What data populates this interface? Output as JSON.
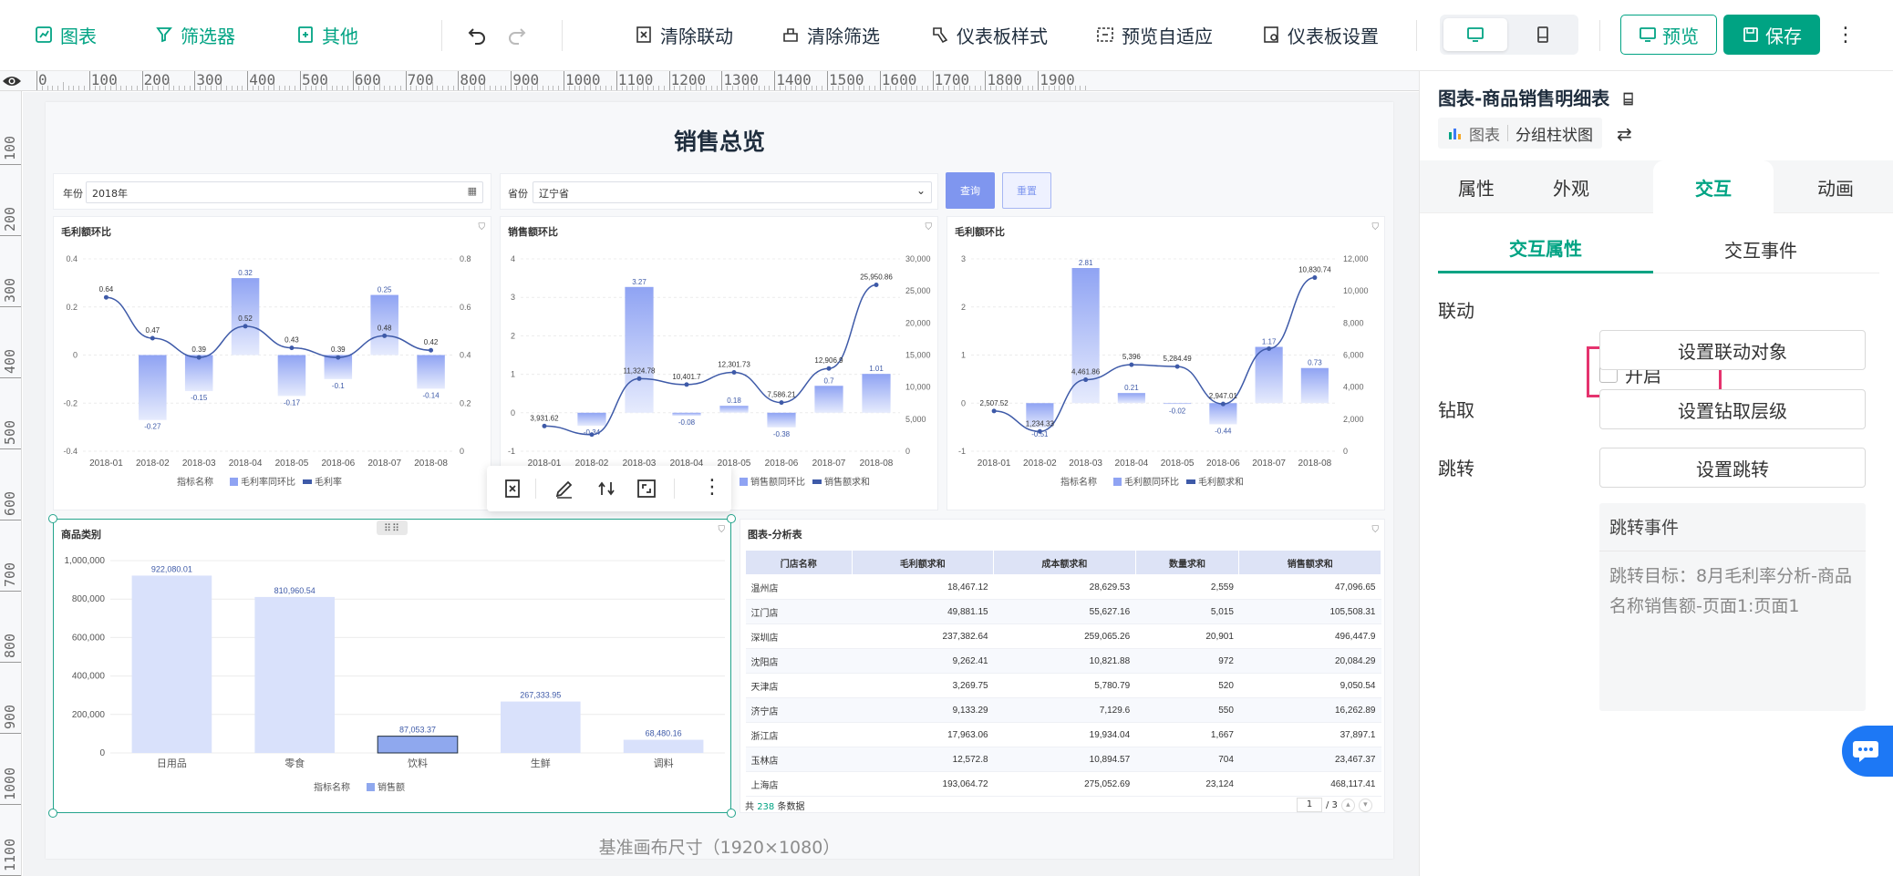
{
  "toolbar": {
    "chart_label": "图表",
    "filter_label": "筛选器",
    "other_label": "其他",
    "clear_link_label": "清除联动",
    "clear_filter_label": "清除筛选",
    "dashboard_style_label": "仪表板样式",
    "preview_adapt_label": "预览自适应",
    "dashboard_settings_label": "仪表板设置",
    "preview_label": "预览",
    "save_label": "保存",
    "accent_color": "#00a383"
  },
  "ruler": {
    "h_ticks": [
      "0",
      "100",
      "200",
      "300",
      "400",
      "500",
      "600",
      "700",
      "800",
      "900",
      "1000",
      "1100",
      "1200",
      "1300",
      "1400",
      "1500",
      "1600",
      "1700",
      "1800",
      "1900"
    ],
    "v_ticks": [
      "100",
      "200",
      "300",
      "400",
      "500",
      "600",
      "700",
      "800",
      "900",
      "1000",
      "1100"
    ]
  },
  "dashboard": {
    "title": "销售总览",
    "base_size": "基准画布尺寸（1920×1080）",
    "filter_year_label": "年份",
    "filter_year_value": "2018年",
    "filter_province_label": "省份",
    "filter_province_value": "辽宁省",
    "query_label": "查询",
    "reset_label": "重置"
  },
  "chart_data": [
    {
      "type": "bar",
      "title": "毛利额环比",
      "categories": [
        "2018-01",
        "2018-02",
        "2018-03",
        "2018-04",
        "2018-05",
        "2018-06",
        "2018-07",
        "2018-08"
      ],
      "series": [
        {
          "name": "毛利率同环比",
          "type": "bar",
          "values": [
            null,
            -0.27,
            -0.15,
            0.32,
            -0.17,
            -0.1,
            0.25,
            -0.14
          ]
        },
        {
          "name": "毛利率",
          "type": "line",
          "values": [
            0.64,
            0.47,
            0.39,
            0.52,
            0.43,
            0.39,
            0.48,
            0.42
          ]
        }
      ],
      "ylim_left": [
        -0.4,
        0.4
      ],
      "yticks_left": [
        "0.4",
        "0.2",
        "0",
        "-0.2",
        "-0.4"
      ],
      "ylim_right": [
        0,
        0.8
      ],
      "yticks_right": [
        "0.8",
        "0.6",
        "0.4",
        "0.2",
        "0"
      ],
      "legend_title": "指标名称"
    },
    {
      "type": "bar",
      "title": "销售额环比",
      "categories": [
        "2018-01",
        "2018-02",
        "2018-03",
        "2018-04",
        "2018-05",
        "2018-06",
        "2018-07",
        "2018-08"
      ],
      "series": [
        {
          "name": "销售额同环比",
          "type": "bar",
          "values": [
            null,
            -0.34,
            3.27,
            -0.08,
            0.18,
            -0.38,
            0.7,
            1.01
          ]
        },
        {
          "name": "销售额求和",
          "type": "line",
          "values": [
            3931.62,
            2595.6,
            11324.78,
            10401.7,
            12301.73,
            7586.21,
            12906.9,
            25950.86
          ]
        }
      ],
      "ylim_left": [
        -1,
        4
      ],
      "yticks_left": [
        "4",
        "3",
        "2",
        "1",
        "0",
        "-1"
      ],
      "ylim_right": [
        0,
        30000
      ],
      "yticks_right": [
        "30,000",
        "25,000",
        "20,000",
        "15,000",
        "10,000",
        "5,000",
        "0"
      ],
      "data_labels_line": [
        "3,931.62",
        "",
        "11,324.78",
        "10,401.7",
        "12,301.73",
        "7,586.21",
        "12,906.9",
        "25,950.86"
      ]
    },
    {
      "type": "bar",
      "title": "毛利额环比",
      "categories": [
        "2018-01",
        "2018-02",
        "2018-03",
        "2018-04",
        "2018-05",
        "2018-06",
        "2018-07",
        "2018-08"
      ],
      "series": [
        {
          "name": "毛利额同环比",
          "type": "bar",
          "values": [
            null,
            -0.51,
            2.81,
            0.21,
            -0.02,
            -0.44,
            1.17,
            0.73
          ]
        },
        {
          "name": "毛利额求和",
          "type": "line",
          "values": [
            2507.52,
            1234.33,
            4461.86,
            5396,
            5284.49,
            2947.01,
            6400,
            10830.74
          ]
        }
      ],
      "ylim_left": [
        -1,
        3
      ],
      "yticks_left": [
        "3",
        "2",
        "1",
        "0",
        "-1"
      ],
      "ylim_right": [
        0,
        12000
      ],
      "yticks_right": [
        "12,000",
        "10,000",
        "8,000",
        "6,000",
        "4,000",
        "2,000",
        "0"
      ],
      "legend_title": "指标名称",
      "data_labels_line": [
        "2,507.52",
        "1,234.33",
        "4,461.86",
        "5,396",
        "5,284.49",
        "2,947.01",
        "",
        "10,830.74"
      ]
    },
    {
      "type": "bar",
      "title": "商品类别",
      "categories": [
        "日用品",
        "零食",
        "饮料",
        "生鲜",
        "调料"
      ],
      "series": [
        {
          "name": "销售额",
          "values": [
            922080.01,
            810960.54,
            87053.37,
            267333.95,
            68480.16
          ]
        }
      ],
      "data_labels": [
        "922,080.01",
        "810,960.54",
        "87,053.37",
        "267,333.95",
        "68,480.16"
      ],
      "ylim": [
        0,
        1000000
      ],
      "yticks": [
        "1,000,000",
        "800,000",
        "600,000",
        "400,000",
        "200,000",
        "0"
      ],
      "legend_title": "指标名称"
    }
  ],
  "table": {
    "title": "图表-分析表",
    "columns": [
      "门店名称",
      "毛利额求和",
      "成本额求和",
      "数量求和",
      "销售额求和"
    ],
    "rows": [
      [
        "温州店",
        "18,467.12",
        "28,629.53",
        "2,559",
        "47,096.65"
      ],
      [
        "江门店",
        "49,881.15",
        "55,627.16",
        "5,015",
        "105,508.31"
      ],
      [
        "深圳店",
        "237,382.64",
        "259,065.26",
        "20,901",
        "496,447.9"
      ],
      [
        "沈阳店",
        "9,262.41",
        "10,821.88",
        "972",
        "20,084.29"
      ],
      [
        "天津店",
        "3,269.75",
        "5,780.79",
        "520",
        "9,050.54"
      ],
      [
        "济宁店",
        "9,133.29",
        "7,129.6",
        "550",
        "16,262.89"
      ],
      [
        "浙江店",
        "17,963.06",
        "19,934.04",
        "1,667",
        "37,897.1"
      ],
      [
        "玉林店",
        "12,572.8",
        "10,894.57",
        "704",
        "23,467.37"
      ],
      [
        "上海店",
        "193,064.72",
        "275,052.69",
        "23,124",
        "468,117.41"
      ]
    ],
    "footer_prefix": "共",
    "footer_count": "238",
    "footer_suffix": "条数据",
    "page_current": "1",
    "page_total": "/ 3"
  },
  "side_panel": {
    "title": "图表-商品销售明细表",
    "type_label": "图表",
    "type_value": "分组柱状图",
    "tabs": [
      "属性",
      "外观",
      "交互",
      "动画"
    ],
    "active_tab": "交互",
    "subtabs": [
      "交互属性",
      "交互事件"
    ],
    "linkage_label": "联动",
    "linkage_enable_label": "开启",
    "linkage_target_btn": "设置联动对象",
    "drill_label": "钻取",
    "drill_btn": "设置钻取层级",
    "jump_label": "跳转",
    "jump_btn": "设置跳转",
    "jump_event_title": "跳转事件",
    "jump_event_desc": "跳转目标：8月毛利率分析-商品名称销售额-页面1:页面1"
  },
  "colors": {
    "bar_gradient_top": "#8fa3f3",
    "bar_gradient_bottom": "#e6ebfd",
    "line": "#3e5aa8",
    "selection": "#24a48c",
    "highlight": "#e5336e"
  }
}
